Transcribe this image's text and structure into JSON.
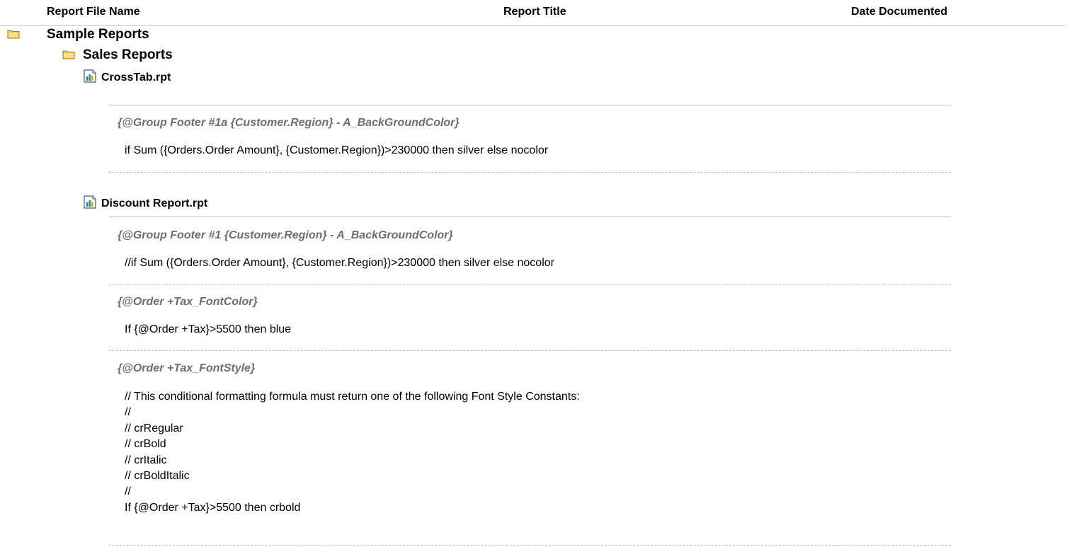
{
  "header": {
    "col_file": "Report File Name",
    "col_title": "Report Title",
    "col_date": "Date Documented"
  },
  "tree": {
    "root_folder": {
      "label": "Sample Reports",
      "icon": "folder-icon"
    },
    "sub_folder": {
      "label": "Sales Reports",
      "icon": "folder-icon"
    }
  },
  "reports": [
    {
      "name": "CrossTab.rpt",
      "icon": "report-icon",
      "formulas": [
        {
          "name": "{@Group Footer #1a {Customer.Region} - A_BackGroundColor}",
          "text": "if Sum ({Orders.Order Amount}, {Customer.Region})>230000 then silver else nocolor"
        }
      ]
    },
    {
      "name": "Discount Report.rpt",
      "icon": "report-icon",
      "formulas": [
        {
          "name": "{@Group Footer #1 {Customer.Region} - A_BackGroundColor}",
          "text": "//if Sum ({Orders.Order Amount}, {Customer.Region})>230000 then silver else nocolor"
        },
        {
          "name": "{@Order +Tax_FontColor}",
          "text": "If {@Order +Tax}>5500 then blue"
        },
        {
          "name": "{@Order +Tax_FontStyle}",
          "text": "// This conditional formatting formula must return one of the following Font Style Constants:\n//\n// crRegular\n// crBold\n// crItalic\n// crBoldItalic\n//\nIf {@Order +Tax}>5500 then crbold"
        }
      ]
    }
  ],
  "colors": {
    "folder_fill": "#f3c94f",
    "folder_stroke": "#a77b12",
    "formula_name": "#6e6e6e",
    "rule": "#bdbdbd"
  }
}
